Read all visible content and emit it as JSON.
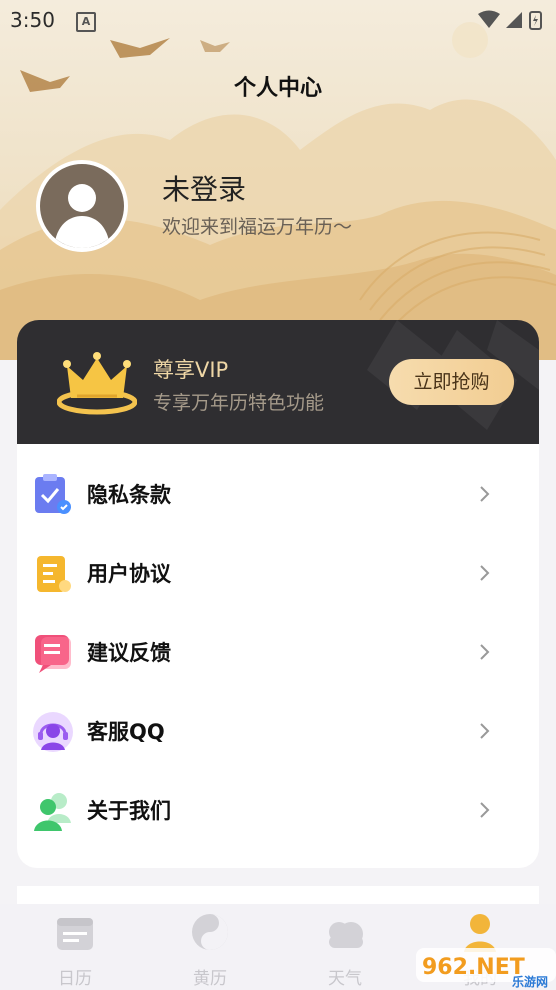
{
  "status_bar": {
    "time": "3:50",
    "notif_letter": "A"
  },
  "header": {
    "title": "个人中心"
  },
  "profile": {
    "name": "未登录",
    "subtitle": "欢迎来到福运万年历～"
  },
  "vip": {
    "title": "尊享VIP",
    "subtitle": "专享万年历特色功能",
    "button": "立即抢购"
  },
  "menu": {
    "items": [
      {
        "label": "隐私条款",
        "icon": "clipboard-check-icon"
      },
      {
        "label": "用户协议",
        "icon": "document-icon"
      },
      {
        "label": "建议反馈",
        "icon": "feedback-icon"
      },
      {
        "label": "客服QQ",
        "icon": "customer-service-icon"
      },
      {
        "label": "关于我们",
        "icon": "people-icon"
      }
    ]
  },
  "tabs": [
    {
      "label": "日历",
      "icon": "calendar-icon"
    },
    {
      "label": "黄历",
      "icon": "yin-yang-icon"
    },
    {
      "label": "天气",
      "icon": "cloud-icon"
    },
    {
      "label": "我的",
      "icon": "user-icon"
    }
  ],
  "watermark": {
    "text": "962.NET",
    "sub": "乐游网"
  },
  "colors": {
    "vip_bg": "#2f2e31",
    "vip_gold": "#efd7a6",
    "button_gold": "#f2cd92",
    "hero_bg": "#efe1c6"
  }
}
